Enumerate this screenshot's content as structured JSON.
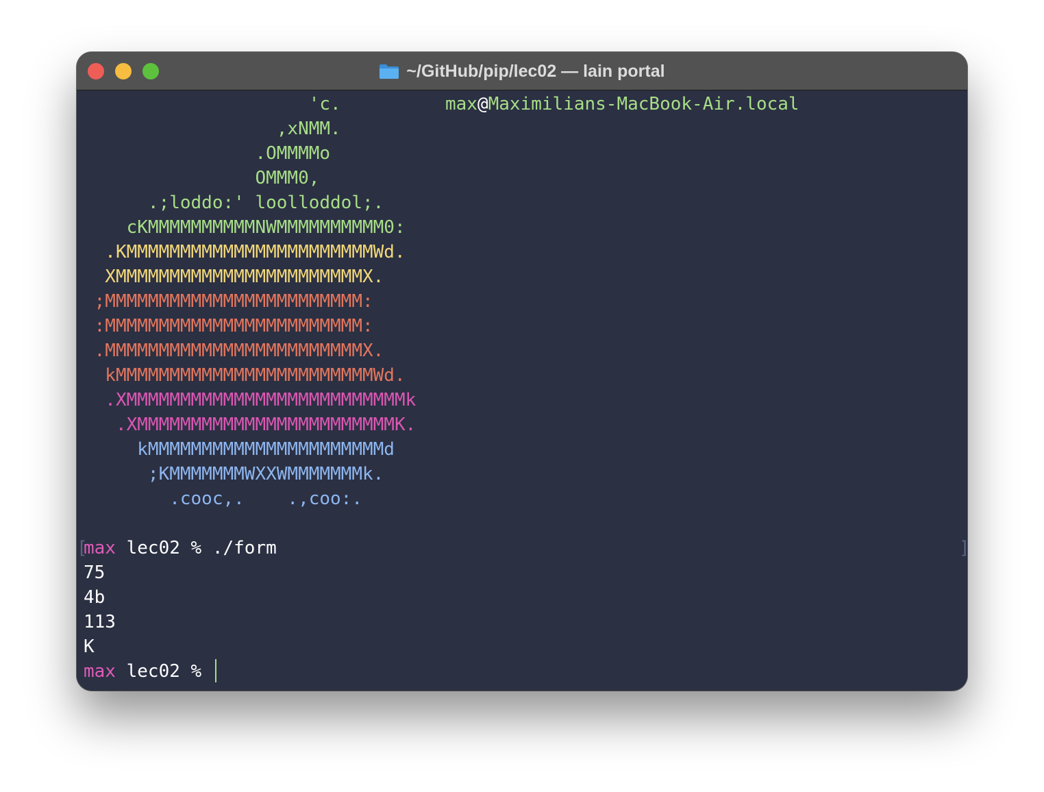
{
  "window": {
    "title": "~/GitHub/pip/lec02 — lain portal",
    "folder_icon": "folder-icon",
    "traffic_lights": {
      "close": "#ee5e57",
      "minimize": "#f6bd40",
      "zoom": "#5ec13e"
    }
  },
  "terminal": {
    "logo_lines": [
      {
        "text": "                     'c.",
        "color": "green"
      },
      {
        "text": "                  ,xNMM.",
        "color": "green"
      },
      {
        "text": "                .OMMMMo",
        "color": "green"
      },
      {
        "text": "                OMMM0,",
        "color": "green"
      },
      {
        "text": "      .;loddo:' loolloddol;.",
        "color": "green"
      },
      {
        "text": "    cKMMMMMMMMMMNWMMMMMMMMMM0:",
        "color": "green"
      },
      {
        "text": "  .KMMMMMMMMMMMMMMMMMMMMMMMWd.",
        "color": "yellow"
      },
      {
        "text": "  XMMMMMMMMMMMMMMMMMMMMMMMX.",
        "color": "yellow"
      },
      {
        "text": " ;MMMMMMMMMMMMMMMMMMMMMMMM:",
        "color": "orange"
      },
      {
        "text": " :MMMMMMMMMMMMMMMMMMMMMMMM:",
        "color": "orange"
      },
      {
        "text": " .MMMMMMMMMMMMMMMMMMMMMMMMX.",
        "color": "orange"
      },
      {
        "text": "  kMMMMMMMMMMMMMMMMMMMMMMMMWd.",
        "color": "orange"
      },
      {
        "text": "  .XMMMMMMMMMMMMMMMMMMMMMMMMMMk",
        "color": "pink"
      },
      {
        "text": "   .XMMMMMMMMMMMMMMMMMMMMMMMMK.",
        "color": "pink"
      },
      {
        "text": "     kMMMMMMMMMMMMMMMMMMMMMMd",
        "color": "blue"
      },
      {
        "text": "      ;KMMMMMMMWXXWMMMMMMMk.",
        "color": "blue"
      },
      {
        "text": "        .cooc,.    .,coo:.",
        "color": "blue"
      }
    ],
    "info_user": "max",
    "info_at": "@",
    "info_host": "Maximilians-MacBook-Air.local",
    "bracket_left": "[",
    "bracket_right": "]",
    "prompt1": {
      "user": "max",
      "rest": " lec02 % ./form"
    },
    "outputs": [
      "75",
      "4b",
      "113",
      "K"
    ],
    "prompt2": {
      "user": "max",
      "rest": " lec02 % "
    }
  },
  "colors": {
    "background": "#2b3043",
    "titlebar": "#525252",
    "green": "#a8de87",
    "yellow": "#f3d879",
    "orange": "#e4765d",
    "pink": "#dc57b3",
    "blue": "#8eb6ef",
    "prompt": "#e05bb8"
  }
}
